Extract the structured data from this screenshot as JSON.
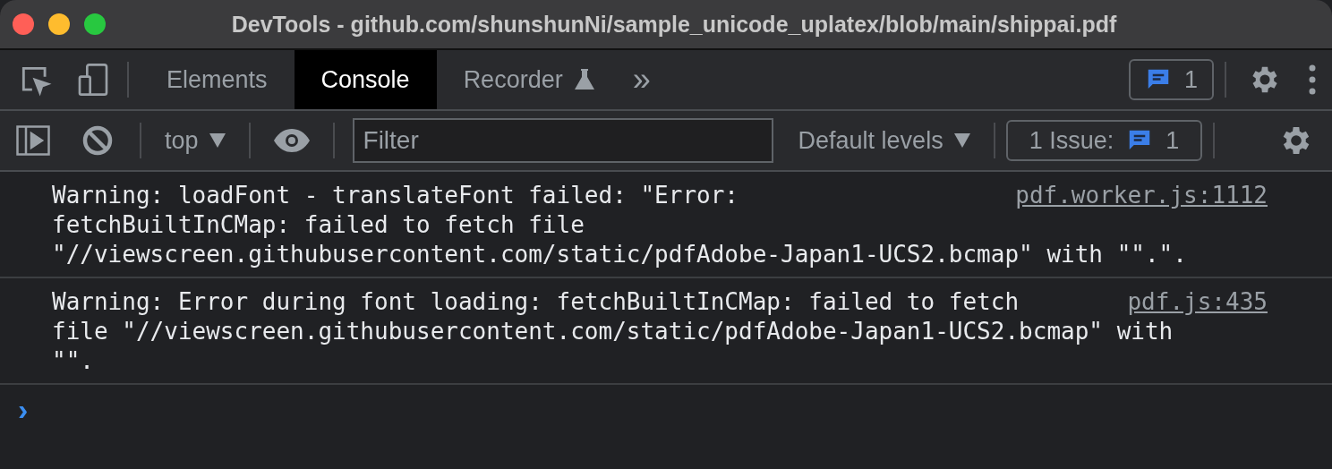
{
  "window": {
    "title": "DevTools - github.com/shunshunNi/sample_unicode_uplatex/blob/main/shippai.pdf"
  },
  "tabs": [
    {
      "label": "Elements",
      "selected": false
    },
    {
      "label": "Console",
      "selected": true
    },
    {
      "label": "Recorder",
      "selected": false,
      "experimental": true
    }
  ],
  "more_tabs": "»",
  "issues_badge": {
    "count": "1"
  },
  "toolbar": {
    "context": "top",
    "filter": {
      "placeholder": "Filter"
    },
    "levels": "Default levels",
    "issues": {
      "label": "1 Issue:",
      "count": "1"
    }
  },
  "messages": [
    {
      "lines": [
        "Warning: loadFont - translateFont failed: \"Error:",
        "fetchBuiltInCMap: failed to fetch file",
        "\"//viewscreen.githubusercontent.com/static/pdfAdobe-Japan1-UCS2.bcmap\" with \"\".\"."
      ],
      "source": "pdf.worker.js:1112"
    },
    {
      "lines": [
        "Warning: Error during font loading: fetchBuiltInCMap: failed to fetch",
        "file \"//viewscreen.githubusercontent.com/static/pdfAdobe-Japan1-UCS2.bcmap\" with",
        "\"\"."
      ],
      "source": "pdf.js:435"
    }
  ],
  "prompt": "›"
}
